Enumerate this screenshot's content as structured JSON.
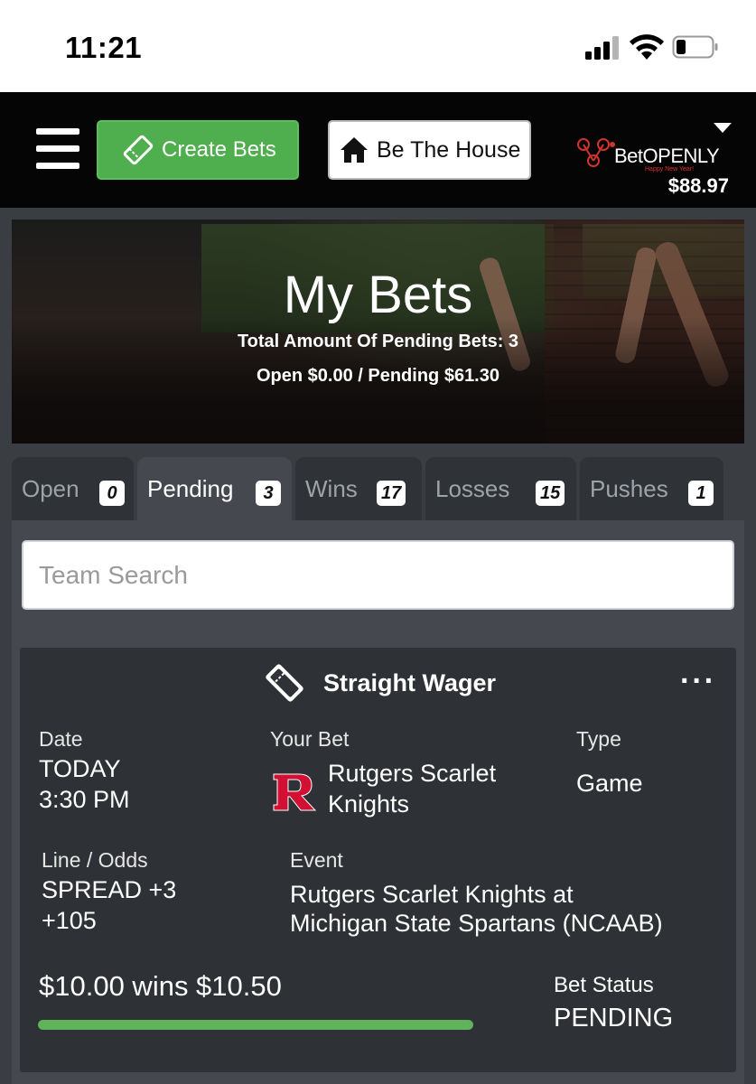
{
  "status_bar": {
    "time": "11:21"
  },
  "nav": {
    "create_label": "Create Bets",
    "house_label": "Be The House",
    "logo_bet": "Bet",
    "logo_openly": "OPENLY",
    "logo_tagline": "Happy New Year!",
    "balance": "$88.97",
    "brand_color": "#4fae4d"
  },
  "hero": {
    "title": "My Bets",
    "total_pending": "Total Amount Of Pending Bets: 3",
    "open_pending": "Open $0.00 / Pending $61.30"
  },
  "tabs": [
    {
      "label": "Open",
      "count": "0"
    },
    {
      "label": "Pending",
      "count": "3"
    },
    {
      "label": "Wins",
      "count": "17"
    },
    {
      "label": "Losses",
      "count": "15"
    },
    {
      "label": "Pushes",
      "count": "1"
    }
  ],
  "search": {
    "placeholder": "Team Search"
  },
  "bet": {
    "title": "Straight Wager",
    "more": "···",
    "date_label": "Date",
    "date_line1": "TODAY",
    "date_line2": "3:30 PM",
    "your_bet_label": "Your Bet",
    "team_line1": "Rutgers Scarlet",
    "team_line2": "Knights",
    "type_label": "Type",
    "type_value": "Game",
    "line_label": "Line / Odds",
    "line_value1": "SPREAD +3",
    "line_value2": "+105",
    "event_label": "Event",
    "event_line1": "Rutgers Scarlet Knights at",
    "event_line2": "Michigan State Spartans (NCAAB)",
    "stake": "$10.00 wins $10.50",
    "progress": 1.0,
    "status_label": "Bet Status",
    "status_value": "PENDING"
  }
}
